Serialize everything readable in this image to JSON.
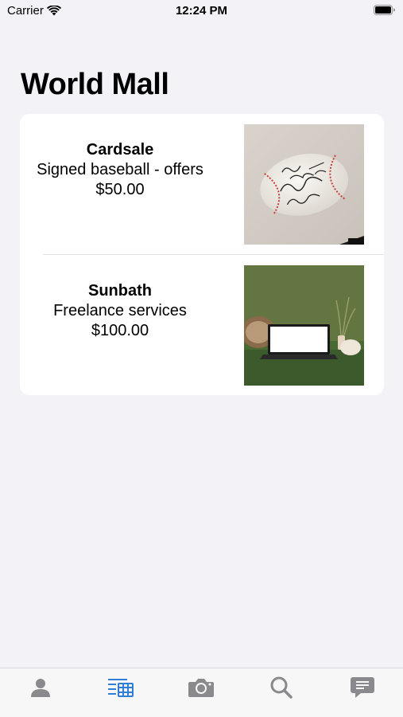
{
  "status_bar": {
    "carrier": "Carrier",
    "time": "12:24 PM"
  },
  "header": {
    "title": "World Mall"
  },
  "listings": [
    {
      "name": "Cardsale",
      "description": "Signed baseball - offers",
      "price": "$50.00",
      "image_icon": "signed-baseball-photo"
    },
    {
      "name": "Sunbath",
      "description": "Freelance services",
      "price": "$100.00",
      "image_icon": "laptop-on-desk-photo"
    }
  ],
  "tab_bar": {
    "items": [
      {
        "icon": "person-icon",
        "selected": false
      },
      {
        "icon": "listings-icon",
        "selected": true
      },
      {
        "icon": "camera-icon",
        "selected": false
      },
      {
        "icon": "search-icon",
        "selected": false
      },
      {
        "icon": "chat-icon",
        "selected": false
      }
    ]
  },
  "colors": {
    "background": "#f2f2f7",
    "card": "#ffffff",
    "tab_selected": "#2f7fd8",
    "tab_unselected": "#8a8a8e"
  }
}
